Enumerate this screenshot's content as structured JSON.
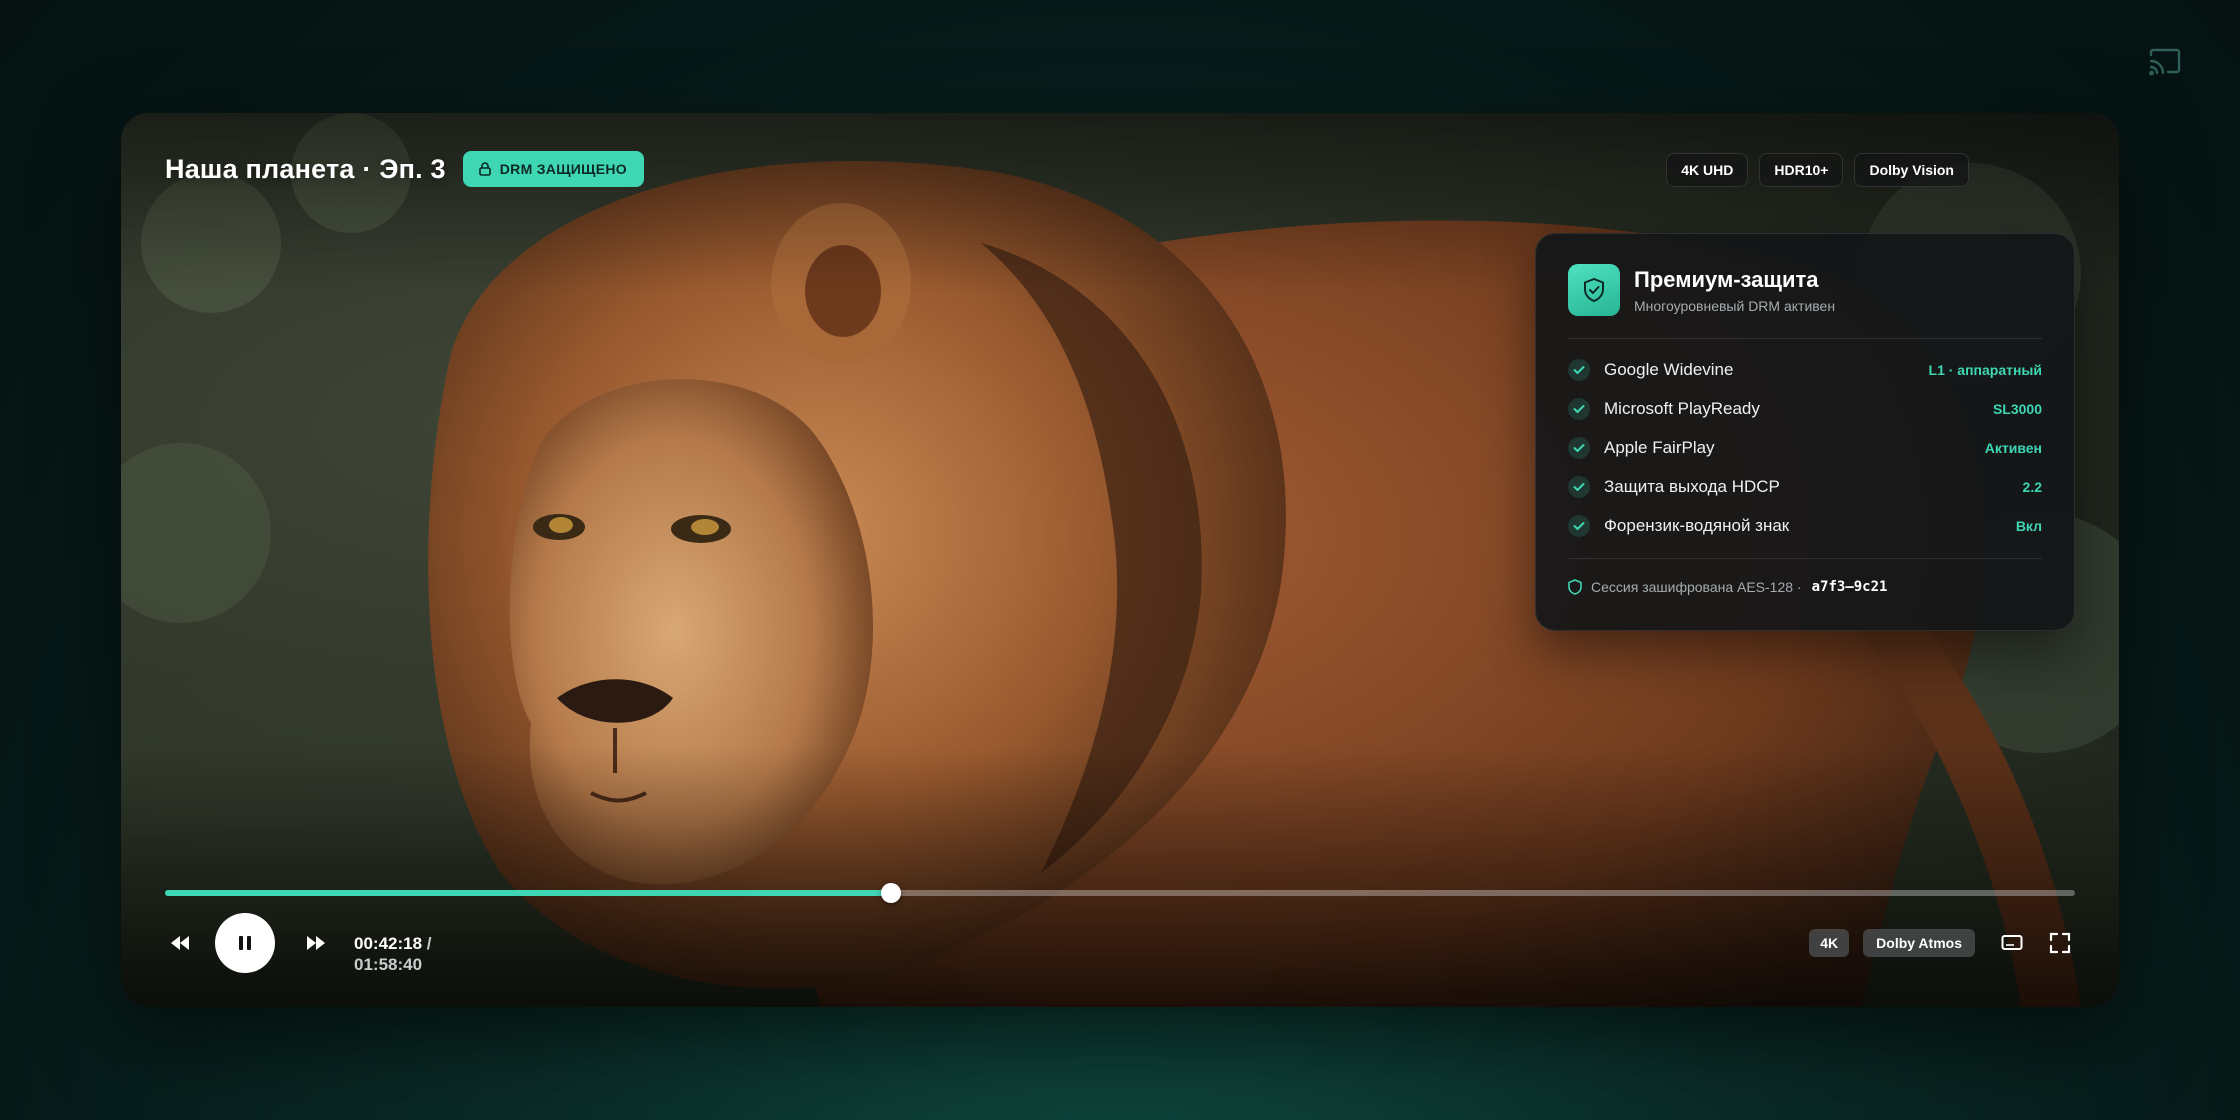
{
  "header": {
    "cast_icon": "cast-icon"
  },
  "player": {
    "title": "Наша планета · Эп. 3",
    "drm_badge": "DRM ЗАЩИЩЕНО",
    "format_badges": [
      "4K UHD",
      "HDR10+",
      "Dolby Vision"
    ],
    "video_description_icon": "video-frame"
  },
  "drm_panel": {
    "title": "Премиум-защита",
    "subtitle": "Многоуровневый DRM активен",
    "items": [
      {
        "label": "Google Widevine",
        "value": "L1 · аппаратный"
      },
      {
        "label": "Microsoft PlayReady",
        "value": "SL3000"
      },
      {
        "label": "Apple FairPlay",
        "value": "Активен"
      },
      {
        "label": "Защита выхода HDCP",
        "value": "2.2"
      },
      {
        "label": "Форензик-водяной знак",
        "value": "Вкл"
      }
    ],
    "footer_text": "Сессия зашифрована AES-128 ·",
    "session_id": "a7f3–9c21",
    "accent_color": "#3fd6b4"
  },
  "playback": {
    "current_time": "00:42:18",
    "separator": "/",
    "total_time": "01:58:40",
    "progress_fraction": 0.38,
    "state": "playing"
  },
  "controls": {
    "quality_badge": "4K",
    "audio_badge": "Dolby Atmos",
    "icons": [
      "rewind-icon",
      "pause-icon",
      "forward-icon",
      "subtitles-icon",
      "fullscreen-icon"
    ]
  }
}
